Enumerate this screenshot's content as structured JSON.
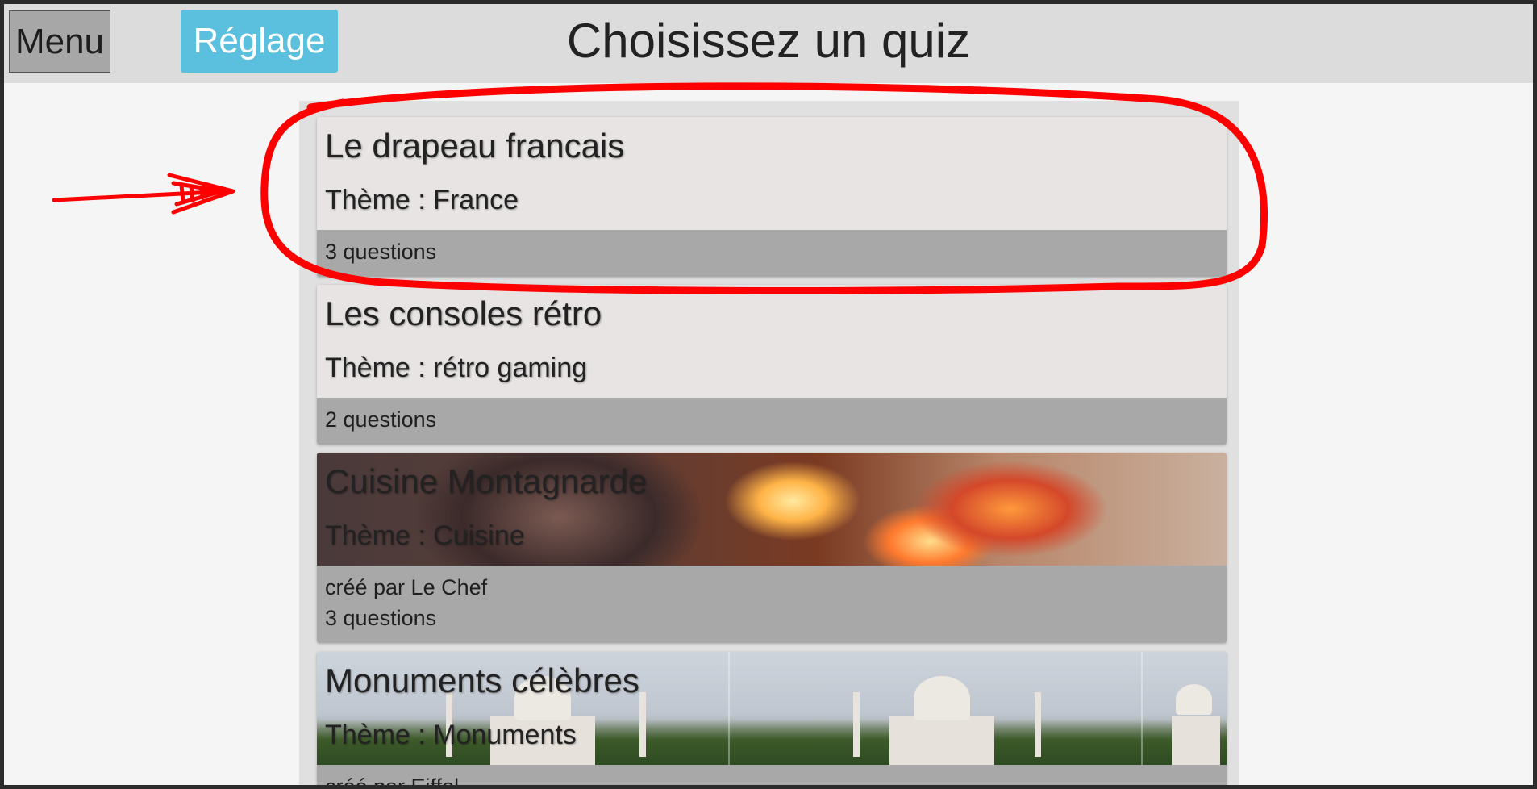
{
  "header": {
    "menu_label": "Menu",
    "settings_label": "Réglage",
    "title": "Choisissez un quiz"
  },
  "quizzes": [
    {
      "title": "Le drapeau francais",
      "theme": "Thème : France",
      "author": "",
      "questions": "3 questions"
    },
    {
      "title": "Les consoles rétro",
      "theme": "Thème : rétro gaming",
      "author": "",
      "questions": "2 questions"
    },
    {
      "title": "Cuisine Montagnarde",
      "theme": "Thème : Cuisine",
      "author": "créé par Le Chef",
      "questions": "3 questions"
    },
    {
      "title": "Monuments célèbres",
      "theme": "Thème : Monuments",
      "author": "créé par Eiffel",
      "questions": ""
    }
  ],
  "colors": {
    "settings_button": "#5bc0de",
    "menu_button": "#a7a7a7",
    "card_top": "#e8e4e4",
    "card_bottom": "#a8a8a8",
    "annotation": "#ff0000"
  }
}
